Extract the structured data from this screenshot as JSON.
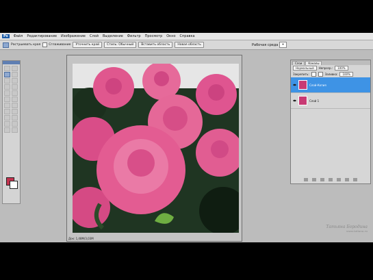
{
  "app": {
    "logo": "Ps",
    "title": "Файл"
  },
  "menu": [
    "Редактирование",
    "Изображение",
    "Слой",
    "Выделение",
    "Фильтр",
    "Просмотр",
    "Окно",
    "Справка"
  ],
  "options_bar": {
    "buttons": [
      "Растушевать края",
      "Сглаживание",
      "Уточнить край",
      "Стиль: Обычный",
      "Вставить область",
      "Новая область"
    ],
    "workspace_label": "Рабочая среда",
    "workspace_value": "▾"
  },
  "colors": {
    "foreground": "#c3334f",
    "background": "#ffffff",
    "accent": "#3e93e5",
    "rose": "#e35c92"
  },
  "document": {
    "status": "Док: 1,48M/3,03M"
  },
  "layers_panel": {
    "tabs": [
      "Слои",
      "Каналы"
    ],
    "blend_mode": "Нормальный",
    "opacity_label": "Непрозр.:",
    "opacity_value": "100%",
    "lock_label": "Закрепить:",
    "fill_label": "Заливка:",
    "fill_value": "100%",
    "layers": [
      {
        "name": "Слой-Копия",
        "active": true
      },
      {
        "name": "Слой 1",
        "active": false
      }
    ]
  },
  "watermark": {
    "name": "Татьяна Бородина",
    "url": "www.tatiana.ru"
  }
}
